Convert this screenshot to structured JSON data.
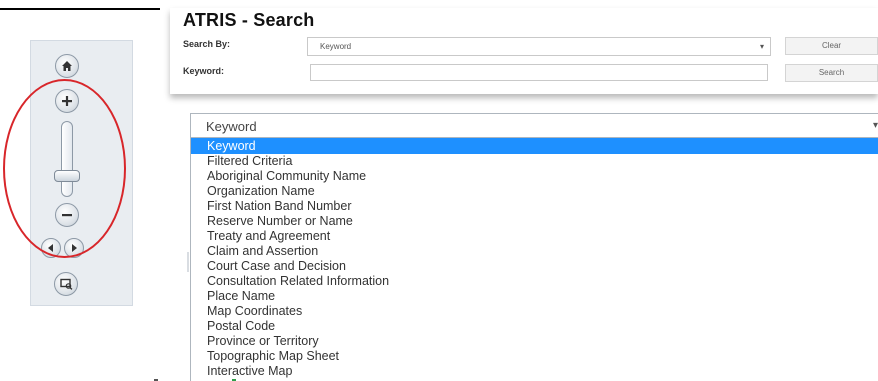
{
  "search_panel": {
    "title": "ATRIS - Search",
    "search_by_label": "Search By:",
    "search_by_value": "Keyword",
    "keyword_label": "Keyword:",
    "keyword_value": "",
    "clear_label": "Clear",
    "search_label": "Search"
  },
  "dropdown": {
    "selected": "Keyword",
    "options": [
      "Keyword",
      "Filtered Criteria",
      "Aboriginal Community Name",
      "Organization Name",
      "First Nation Band Number",
      "Reserve Number or Name",
      "Treaty and Agreement",
      "Claim and Assertion",
      "Court Case and Decision",
      "Consultation Related Information",
      "Place Name",
      "Map Coordinates",
      "Postal Code",
      "Province or Territory",
      "Topographic Map Sheet",
      "Interactive Map"
    ]
  },
  "map_controls": {
    "icons": [
      "home-icon",
      "zoom-in-icon",
      "zoom-slider",
      "zoom-out-icon",
      "pan-left-icon",
      "pan-right-icon",
      "full-extent-icon"
    ],
    "highlight_color": "#d8262a"
  },
  "colors": {
    "selection": "#1e90ff",
    "panel_bg": "#e9edf1"
  }
}
